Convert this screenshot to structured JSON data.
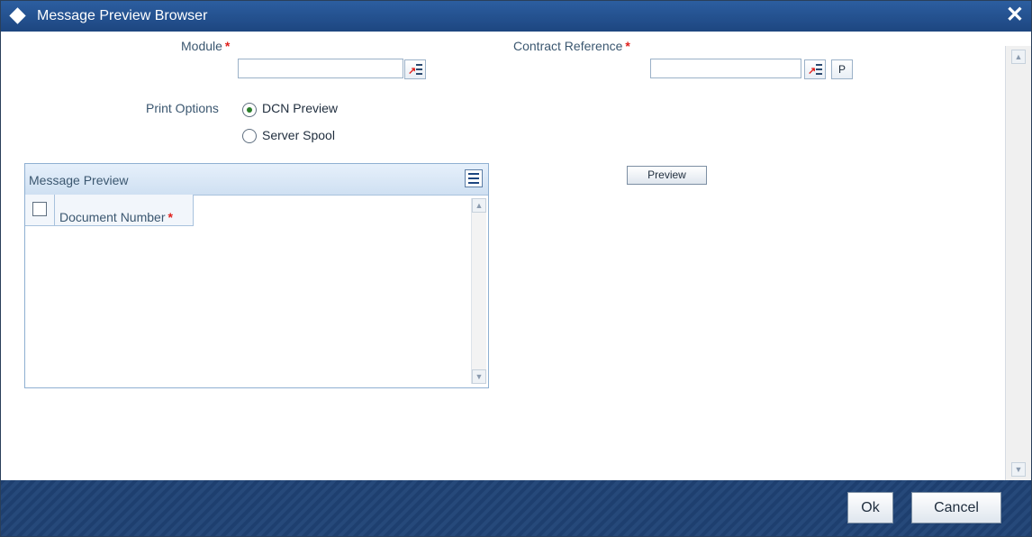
{
  "window": {
    "title": "Message Preview Browser",
    "close_icon": "close-icon"
  },
  "form": {
    "module_label": "Module",
    "module_value": "",
    "contract_reference_label": "Contract Reference",
    "contract_reference_value": "",
    "required_mark": "*",
    "p_button_label": "P",
    "print_options_label": "Print Options",
    "print_options": [
      {
        "label": "DCN Preview",
        "selected": true
      },
      {
        "label": "Server Spool",
        "selected": false
      }
    ]
  },
  "message_preview": {
    "title": "Message Preview",
    "columns": [
      {
        "label": "Document Number",
        "required": true
      }
    ],
    "rows": []
  },
  "preview_button_label": "Preview",
  "footer": {
    "ok_label": "Ok",
    "cancel_label": "Cancel"
  },
  "colors": {
    "title_bar": "#1d4680",
    "required_marker": "#e0211d",
    "footer": "#1e3f6f"
  }
}
